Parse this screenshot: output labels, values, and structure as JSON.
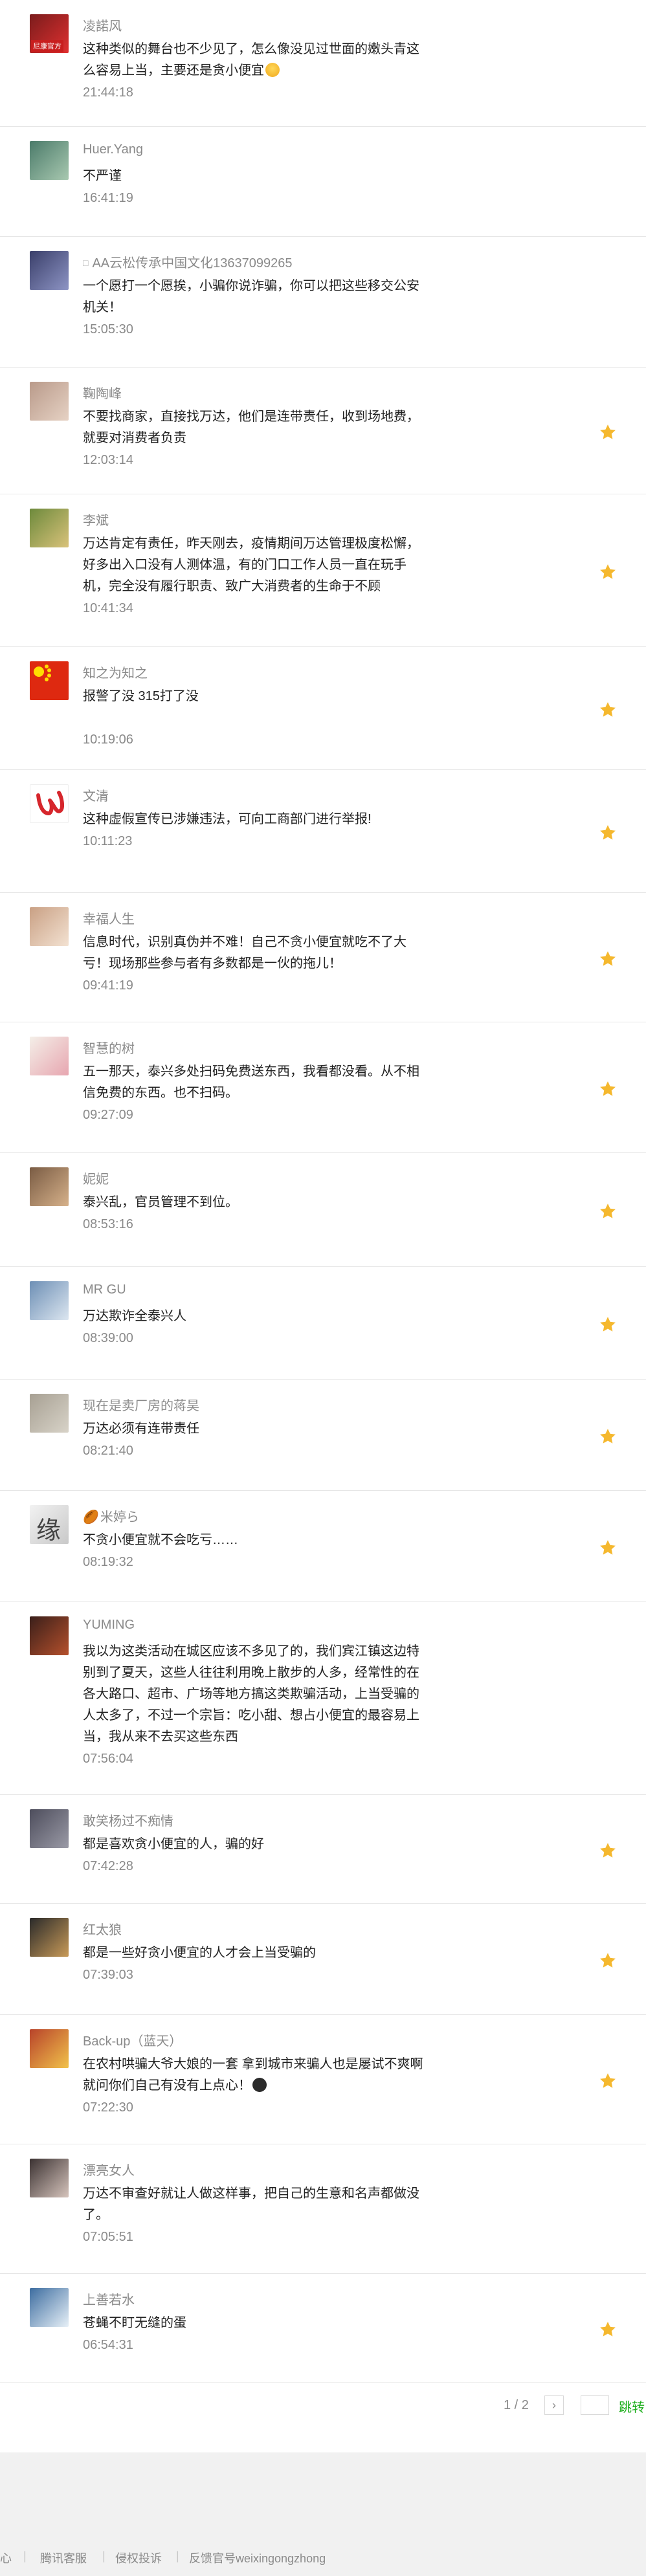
{
  "colors": {
    "star": "#f5b82e",
    "link_green": "#1aad19",
    "footer_bg": "#f1f1f1",
    "divider": "#e6e6e6"
  },
  "comments": [
    {
      "nick": "凌諾风",
      "content": "这种类似的舞台也不少见了，怎么像没见过世面的嫩头青这么容易上当，主要还是贪小便宜",
      "emoji": "grinning-face",
      "time": "21:44:18",
      "starred": false,
      "avatar_colors": [
        "#7a1c1c",
        "#e03030"
      ],
      "avatar_badge": "尼康官方"
    },
    {
      "nick": "Huer.Yang",
      "content": "不严谨",
      "time": "16:41:19",
      "starred": false,
      "avatar_colors": [
        "#4b7b6a",
        "#a8c8b0"
      ]
    },
    {
      "nick": "AA云松传承中国文化13637099265",
      "nick_icon": "□",
      "content": "一个愿打一个愿挨，小骗你说诈骗，你可以把这些移交公安机关！",
      "time": "15:05:30",
      "starred": false,
      "avatar_colors": [
        "#3a3f6a",
        "#8d94c4"
      ]
    },
    {
      "nick": "鞠陶峰",
      "content": "不要找商家，直接找万达，他们是连带责任，收到场地费，就要对消费者负责",
      "time": "12:03:14",
      "starred": true,
      "avatar_colors": [
        "#b99a8a",
        "#e6d2c4"
      ]
    },
    {
      "nick": "李斌",
      "content": "万达肯定有责任，昨天刚去，疫情期间万达管理极度松懈，好多出入口没有人测体温，有的门口工作人员一直在玩手机，完全没有履行职责、致广大消费者的生命于不顾",
      "time": "10:41:34",
      "starred": true,
      "avatar_colors": [
        "#6d8a3c",
        "#d9c27a"
      ]
    },
    {
      "nick": "知之为知之",
      "content": "报警了没   315打了没",
      "time": "10:19:06",
      "starred": true,
      "avatar_colors": [
        "#de2910",
        "#de2910"
      ],
      "flag": true
    },
    {
      "nick": "文清",
      "content": "这种虚假宣传已涉嫌违法，可向工商部门进行举报!",
      "time": "10:11:23",
      "starred": true,
      "avatar_colors": [
        "#ffffff",
        "#ffffff"
      ],
      "logo": true
    },
    {
      "nick": "幸福人生",
      "content": "信息时代，识别真伪并不难！自己不贪小便宜就吃不了大亏！现场那些参与者有多数都是一伙的拖儿！",
      "time": "09:41:19",
      "starred": true,
      "avatar_colors": [
        "#c9a084",
        "#f3e2d2"
      ]
    },
    {
      "nick": "智慧的树",
      "content": "五一那天，泰兴多处扫码免费送东西，我看都没看。从不相信免费的东西。也不扫码。",
      "time": "09:27:09",
      "starred": true,
      "avatar_colors": [
        "#f4efe8",
        "#e7a6b0"
      ]
    },
    {
      "nick": "妮妮",
      "content": "泰兴乱，官员管理不到位。",
      "time": "08:53:16",
      "starred": true,
      "avatar_colors": [
        "#7a5c44",
        "#d6b18a"
      ]
    },
    {
      "nick": "MR GU",
      "content": "万达欺诈全泰兴人",
      "time": "08:39:00",
      "starred": true,
      "avatar_colors": [
        "#6d8fb5",
        "#dce6f0"
      ]
    },
    {
      "nick": "现在是卖厂房的蒋昊",
      "content": "万达必须有连带责任",
      "time": "08:21:40",
      "starred": true,
      "avatar_colors": [
        "#a7a093",
        "#d8d3c8"
      ]
    },
    {
      "nick": "米婷ら",
      "nick_prefix": "🏉",
      "content": "不贪小便宜就不会吃亏……",
      "time": "08:19:32",
      "starred": true,
      "avatar_colors": [
        "#f2f2f2",
        "#c9c9c9"
      ],
      "avatar_char": "缘"
    },
    {
      "nick": "YUMING",
      "content": "我以为这类活动在城区应该不多见了的，我们宾江镇这边特别到了夏天，这些人往往利用晚上散步的人多，经常性的在各大路口、超市、广场等地方搞这类欺骗活动，上当受骗的人太多了，不过一个宗旨：吃小甜、想占小便宜的最容易上当，我从来不去买这些东西",
      "time": "07:56:04",
      "starred": false,
      "avatar_colors": [
        "#3a1f1a",
        "#b5502c"
      ]
    },
    {
      "nick": "敢笑杨过不痴情",
      "content": "都是喜欢贪小便宜的人，骗的好",
      "time": "07:42:28",
      "starred": true,
      "avatar_colors": [
        "#4d4d5c",
        "#9a9aa6"
      ]
    },
    {
      "nick": "红太狼",
      "content": "都是一些好贪小便宜的人才会上当受骗的",
      "time": "07:39:03",
      "starred": true,
      "avatar_colors": [
        "#2a2a2a",
        "#c89a58"
      ]
    },
    {
      "nick": "Back-up（蓝天）",
      "content": "在农村哄骗大爷大娘的一套 拿到城市来骗人也是屡试不爽啊  就问你们自己有没有上点心！",
      "emoji": "sunglasses-face",
      "time": "07:22:30",
      "starred": true,
      "avatar_colors": [
        "#b8432a",
        "#f1c24b"
      ]
    },
    {
      "nick": "漂亮女人",
      "content": "万达不审查好就让人做这样事，把自己的生意和名声都做没了。",
      "time": "07:05:51",
      "starred": false,
      "avatar_colors": [
        "#3b3232",
        "#d6c4bc"
      ]
    },
    {
      "nick": "上善若水",
      "content": "苍蝇不盯无缝的蛋",
      "time": "06:54:31",
      "starred": true,
      "avatar_colors": [
        "#3d6da0",
        "#e7f0f7"
      ]
    }
  ],
  "pager": {
    "info": "1 / 2",
    "next_label": "›",
    "go_label": "跳转",
    "input_value": ""
  },
  "footer": {
    "links": [
      "心",
      "腾讯客服",
      "侵权投诉",
      "反馈官号weixingongzhong"
    ]
  }
}
